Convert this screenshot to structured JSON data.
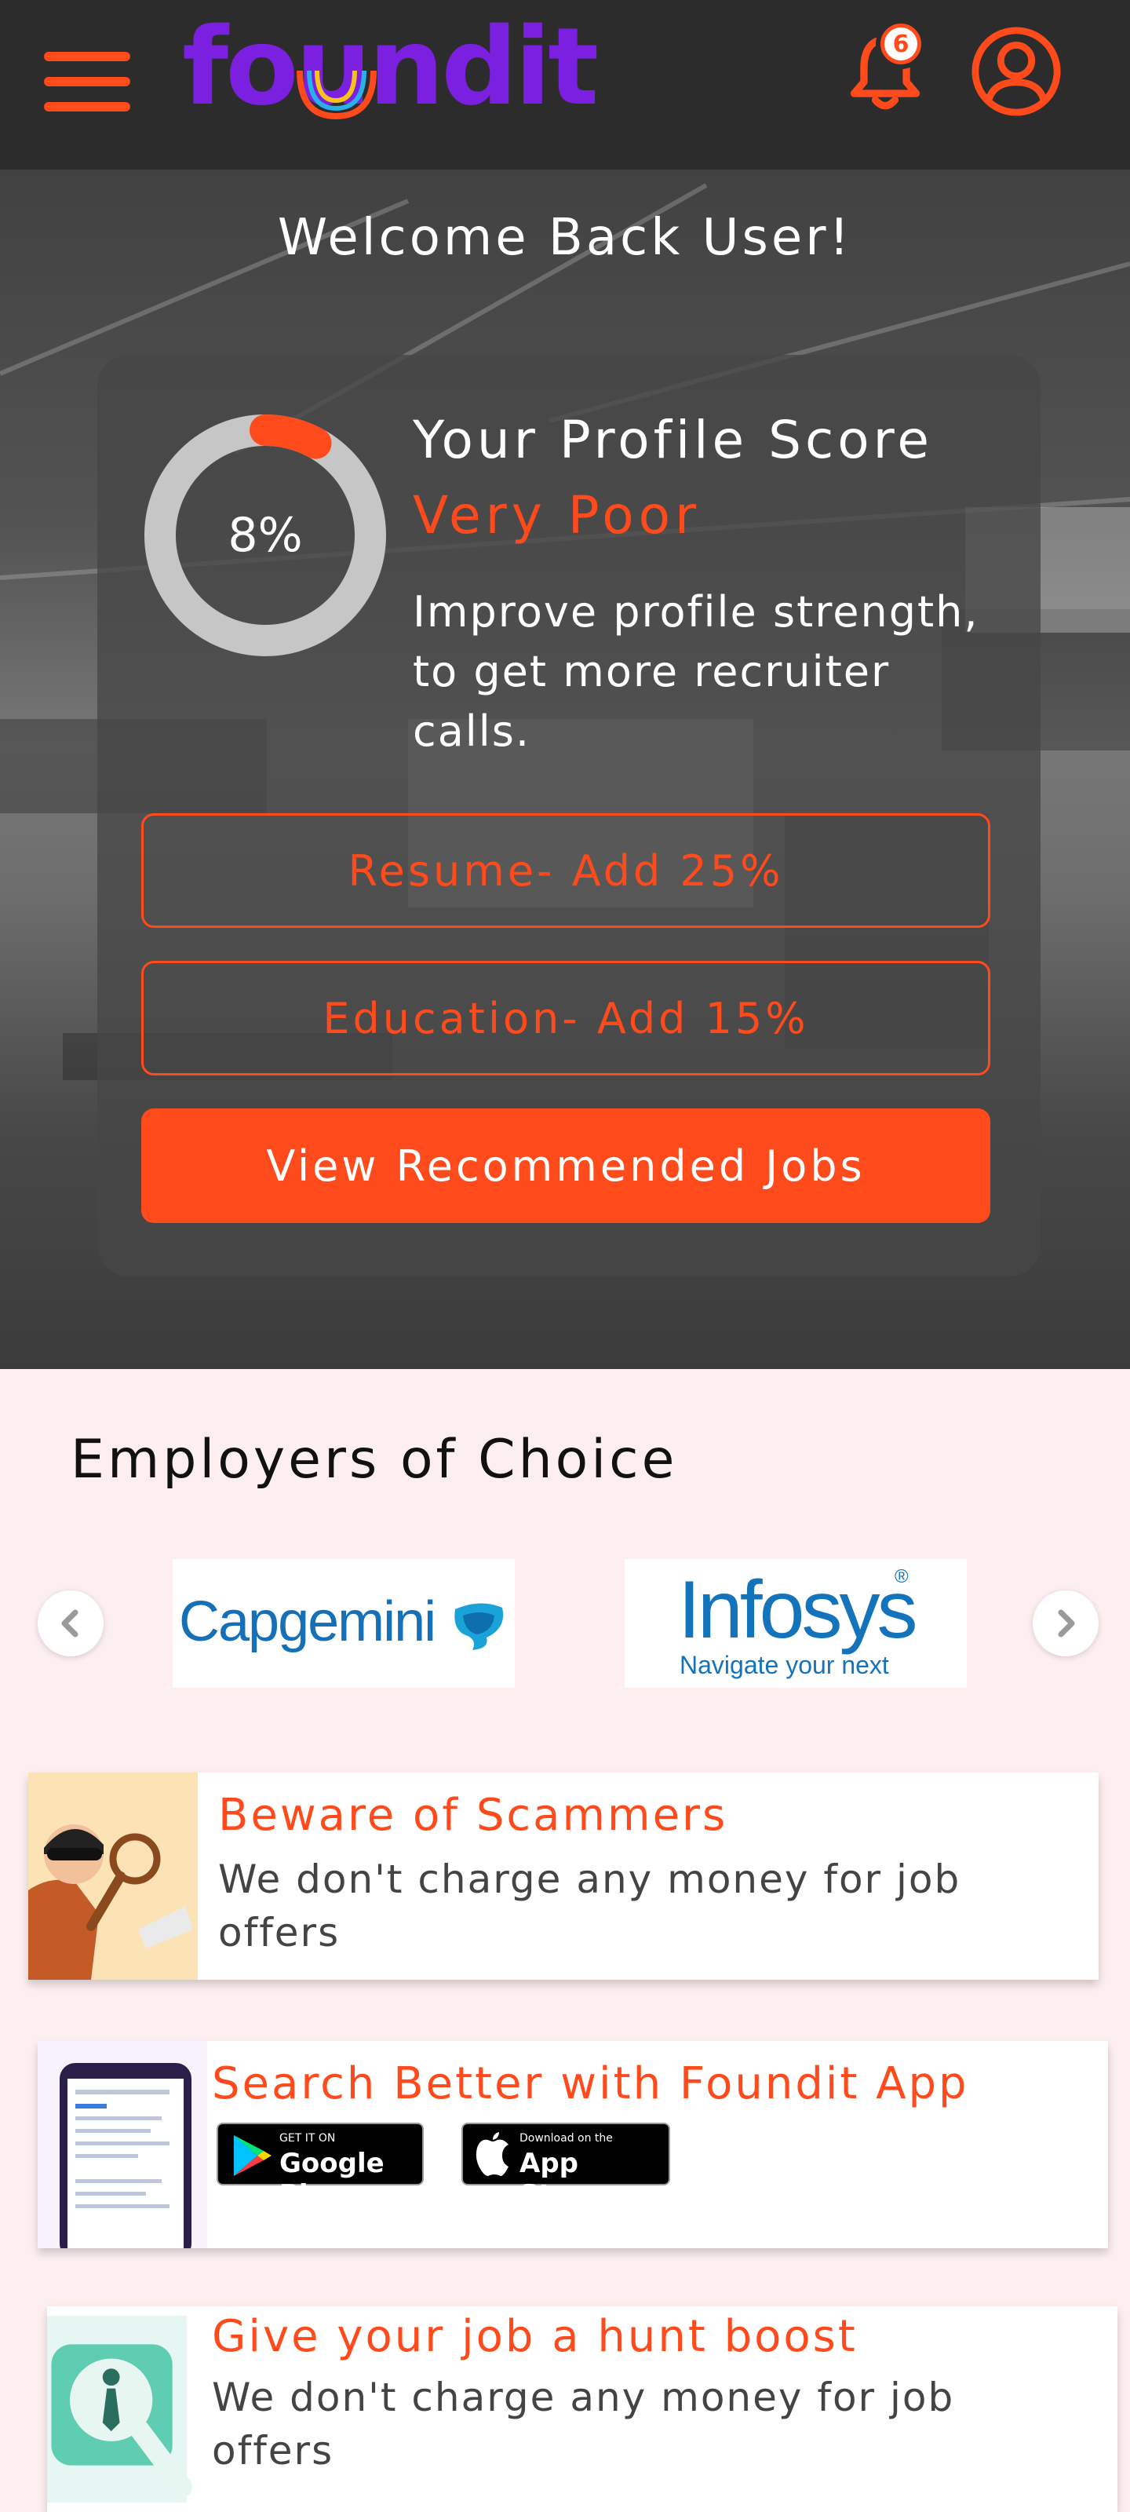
{
  "header": {
    "logo_text": "foundit",
    "notification_count": "6"
  },
  "hero": {
    "welcome": "Welcome Back User!"
  },
  "profile_score": {
    "percent_label": "8%",
    "percent_value": 8,
    "title": "Your Profile Score",
    "level": "Very Poor",
    "description": "Improve profile strength, to get more recruiter calls.",
    "resume_button": "Resume- Add 25%",
    "education_button": "Education- Add 15%",
    "cta_button": "View Recommended Jobs"
  },
  "employers": {
    "title": "Employers of Choice",
    "logos": [
      {
        "name": "Capgemini",
        "text": "Capgemini"
      },
      {
        "name": "Infosys",
        "text": "Infosys",
        "tagline": "Navigate your next",
        "mark": "®"
      }
    ]
  },
  "promos": {
    "scam": {
      "title": "Beware of Scammers",
      "text": "We don't charge any money for job offers"
    },
    "app": {
      "title": "Search Better with Foundit App",
      "google_small": "GET IT ON",
      "google_big": "Google Play",
      "apple_small": "Download on the",
      "apple_big": "App Store"
    },
    "boost": {
      "title": "Give your job a hunt boost",
      "text": "We don't charge any money for job offers"
    }
  },
  "colors": {
    "accent": "#ff4a1c",
    "header_bg": "#2c2c2c",
    "logo_purple": "#7b1fe0",
    "page_bg": "#fdefef"
  }
}
